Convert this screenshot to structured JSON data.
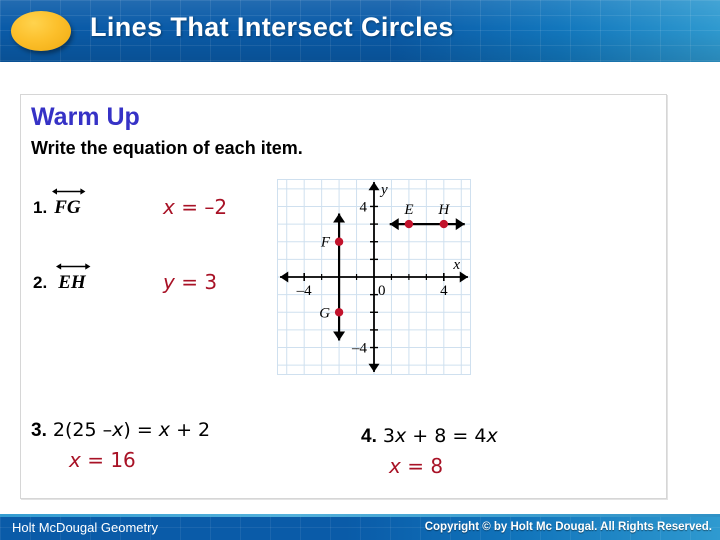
{
  "header": {
    "title": "Lines That Intersect Circles",
    "bg_color": "#0a5ba8",
    "accent_color": "#fcc02c"
  },
  "panel": {
    "heading": "Warm Up",
    "heading_color": "#3632c6",
    "instruction": "Write the equation of each item.",
    "answer_color": "#a81226",
    "items": [
      {
        "number": "1.",
        "label": "FG",
        "notation": "line-double-arrow",
        "answer": "x = –2"
      },
      {
        "number": "2.",
        "label": "EH",
        "notation": "line-double-arrow",
        "answer": "y = 3"
      },
      {
        "number": "3.",
        "expression_prefix": "2(25 –",
        "expression_var": "x",
        "expression_suffix": ") = ",
        "expression_var2": "x",
        "expression_tail": " + 2",
        "answer_var": "x",
        "answer_rest": " = 16"
      },
      {
        "number": "4.",
        "expression_prefix": "3",
        "expression_var": "x",
        "expression_suffix": " + 8 = 4",
        "expression_var2": "x",
        "expression_tail": "",
        "answer_var": "x",
        "answer_rest": " = 8"
      }
    ]
  },
  "chart_data": {
    "type": "scatter",
    "title": "",
    "xlabel": "x",
    "ylabel": "y",
    "xlim": [
      -5.5,
      5.5
    ],
    "ylim": [
      -5.5,
      5.5
    ],
    "grid": true,
    "grid_color": "#cfe0ef",
    "axis_color": "#000000",
    "point_color": "#c2132c",
    "x_ticks": [
      -4,
      0,
      4
    ],
    "y_ticks": [
      -4,
      4
    ],
    "x_tick_labels": [
      "–4",
      "0",
      "4"
    ],
    "y_tick_labels": [
      "–4",
      "4"
    ],
    "points": [
      {
        "name": "F",
        "x": -2,
        "y": 2,
        "label_side": "left"
      },
      {
        "name": "G",
        "x": -2,
        "y": -2,
        "label_side": "left"
      },
      {
        "name": "E",
        "x": 2,
        "y": 3,
        "label_side": "top"
      },
      {
        "name": "H",
        "x": 4,
        "y": 3,
        "label_side": "top"
      }
    ],
    "lines": [
      {
        "name": "FG",
        "orientation": "vertical",
        "at": -2,
        "from": -3.6,
        "to": 3.6,
        "arrows": "both"
      },
      {
        "name": "EH",
        "orientation": "horizontal",
        "at": 3,
        "from": 0.9,
        "to": 5.2,
        "arrows": "both"
      }
    ]
  },
  "footer": {
    "left_text": "Holt McDougal Geometry",
    "right_text": "Copyright © by Holt Mc Dougal. All Rights Reserved."
  }
}
